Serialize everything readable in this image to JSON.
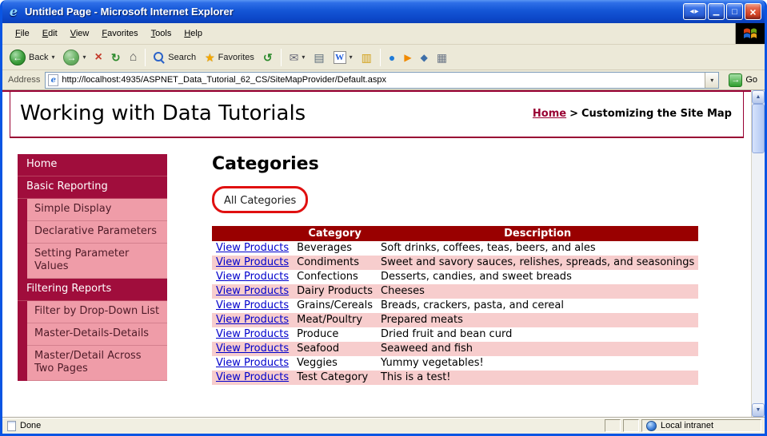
{
  "window": {
    "title": "Untitled Page - Microsoft Internet Explorer"
  },
  "menu": {
    "items": [
      "File",
      "Edit",
      "View",
      "Favorites",
      "Tools",
      "Help"
    ]
  },
  "toolbar": {
    "back_label": "Back",
    "search_label": "Search",
    "favorites_label": "Favorites"
  },
  "address_bar": {
    "label": "Address",
    "url": "http://localhost:4935/ASPNET_Data_Tutorial_62_CS/SiteMapProvider/Default.aspx",
    "go_label": "Go"
  },
  "icons": {
    "ie_logo": "e",
    "window_arrows": "◂▸",
    "window_minimize": "▁",
    "window_maximize": "□",
    "window_close": "×",
    "back_arrow": "←",
    "forward_arrow": "→",
    "stop": "×",
    "refresh": "↻",
    "home": "⌂",
    "favorites_star": "★",
    "history": "↺",
    "mail": "✉",
    "print": "▤",
    "edit_word": "W",
    "discuss": "▥",
    "messenger": "●",
    "addon_arrow": "▶",
    "addon_diamond": "◆",
    "addon_grid": "▦",
    "dropdown_caret": "▾",
    "go_arrow": "→",
    "scroll_up": "▲",
    "scroll_down": "▼"
  },
  "page": {
    "header": {
      "title": "Working with Data Tutorials",
      "breadcrumb_home": "Home",
      "breadcrumb_separator": ">",
      "breadcrumb_current": "Customizing the Site Map"
    },
    "sidebar": {
      "items": [
        {
          "label": "Home",
          "level": 1
        },
        {
          "label": "Basic Reporting",
          "level": 1
        },
        {
          "label": "Simple Display",
          "level": 2
        },
        {
          "label": "Declarative Parameters",
          "level": 2
        },
        {
          "label": "Setting Parameter Values",
          "level": 2
        },
        {
          "label": "Filtering Reports",
          "level": 1
        },
        {
          "label": "Filter by Drop-Down List",
          "level": 2
        },
        {
          "label": "Master-Details-Details",
          "level": 2
        },
        {
          "label": "Master/Detail Across Two Pages",
          "level": 2
        }
      ]
    },
    "main": {
      "title": "Categories",
      "all_categories_label": "All Categories",
      "table": {
        "headers": [
          "",
          "Category",
          "Description"
        ],
        "link_label": "View Products",
        "rows": [
          {
            "category": "Beverages",
            "description": "Soft drinks, coffees, teas, beers, and ales"
          },
          {
            "category": "Condiments",
            "description": "Sweet and savory sauces, relishes, spreads, and seasonings"
          },
          {
            "category": "Confections",
            "description": "Desserts, candies, and sweet breads"
          },
          {
            "category": "Dairy Products",
            "description": "Cheeses"
          },
          {
            "category": "Grains/Cereals",
            "description": "Breads, crackers, pasta, and cereal"
          },
          {
            "category": "Meat/Poultry",
            "description": "Prepared meats"
          },
          {
            "category": "Produce",
            "description": "Dried fruit and bean curd"
          },
          {
            "category": "Seafood",
            "description": "Seaweed and fish"
          },
          {
            "category": "Veggies",
            "description": "Yummy vegetables!"
          },
          {
            "category": "Test Category",
            "description": "This is a test!"
          }
        ]
      }
    }
  },
  "status_bar": {
    "status": "Done",
    "zone": "Local intranet"
  },
  "colors": {
    "window_border": "#0A55E3",
    "maroon_accent": "#990033",
    "table_header_bg": "#990000",
    "table_alt_row": "#F7CDCD",
    "sidebar_item_bg": "#A00D3C",
    "sidebar_subitem_bg": "#EF9CA8",
    "link_blue": "#0000CC",
    "annotation_red": "#E01010"
  }
}
